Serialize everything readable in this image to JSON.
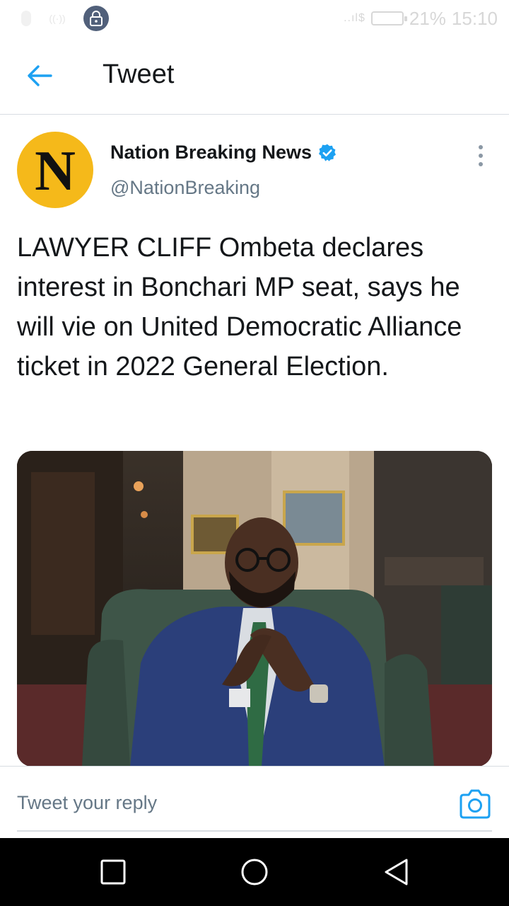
{
  "status_bar": {
    "battery": "21%",
    "time": "15:10"
  },
  "header": {
    "title": "Tweet"
  },
  "tweet": {
    "avatar_letter": "N",
    "author_name": "Nation Breaking News",
    "author_handle": "@NationBreaking",
    "text": "LAWYER CLIFF Ombeta declares interest in Bonchari MP seat, says he will vie on United Democratic Alliance ticket in 2022 General Election."
  },
  "reply": {
    "placeholder": "Tweet your reply"
  },
  "colors": {
    "accent": "#1da1f2",
    "avatar_bg": "#f5b91a",
    "text_primary": "#14171a",
    "text_secondary": "#657786"
  },
  "icons": {
    "back": "back-arrow-icon",
    "verified": "verified-badge-icon",
    "more": "more-vertical-icon",
    "camera": "camera-icon",
    "nav_recents": "recents-square-icon",
    "nav_home": "home-circle-icon",
    "nav_back": "back-triangle-icon"
  }
}
